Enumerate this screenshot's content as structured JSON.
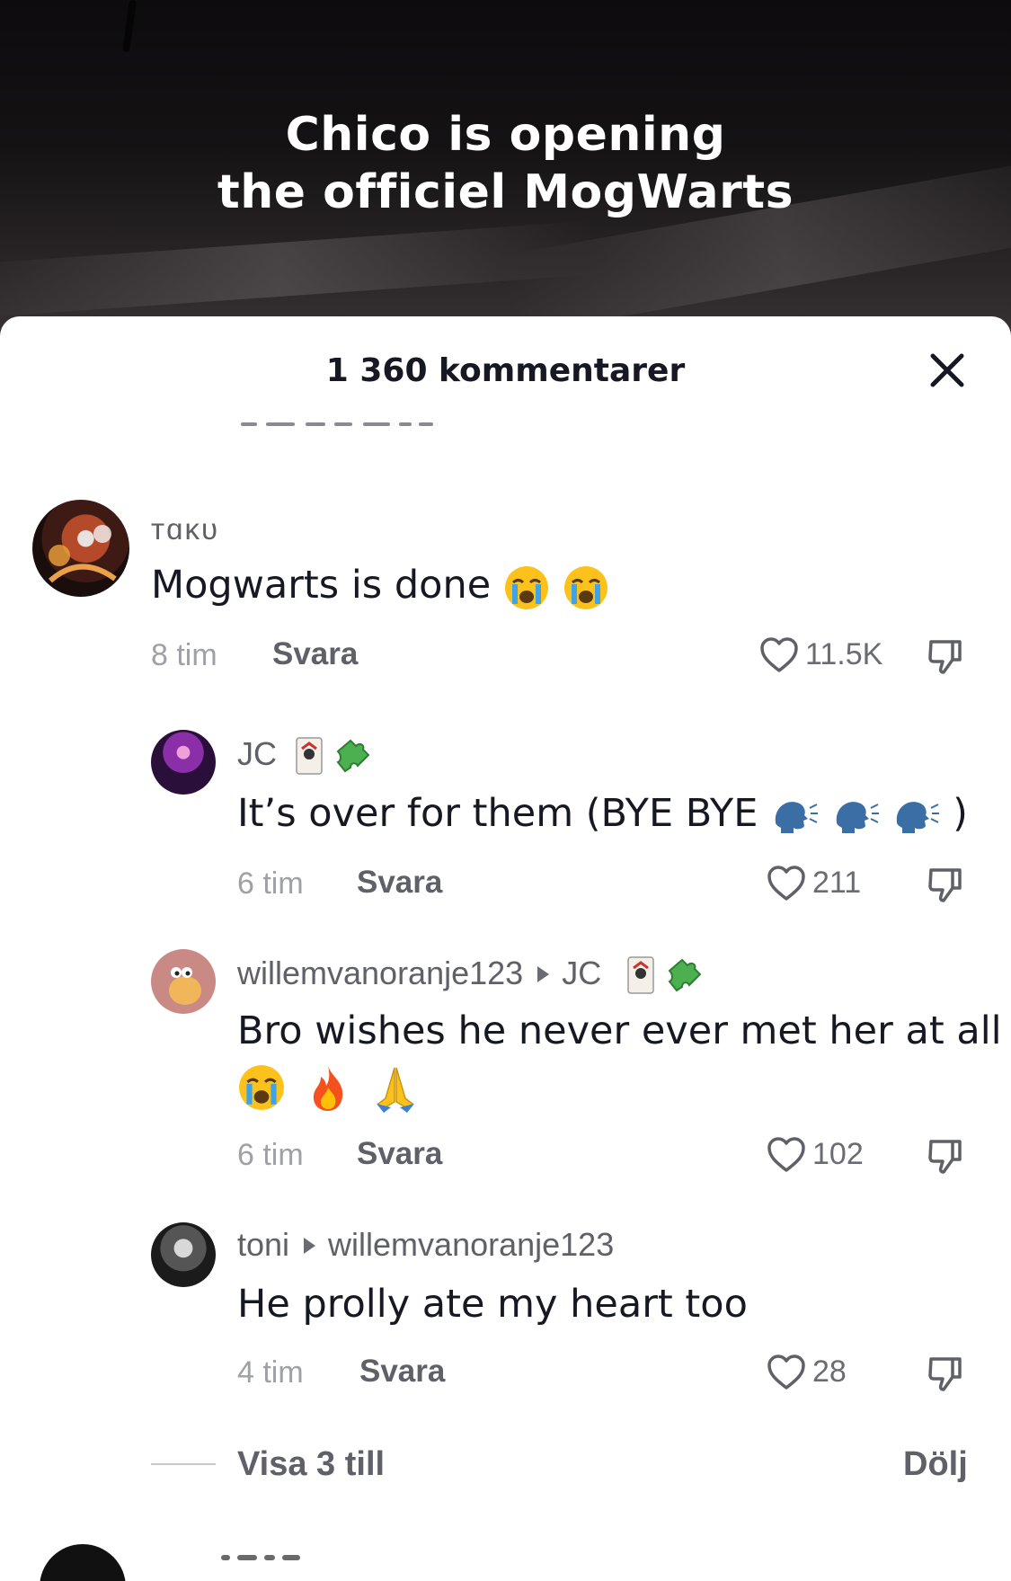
{
  "video": {
    "caption_line1": "Chico is opening",
    "caption_line2": "the officiel MogWarts"
  },
  "sheet": {
    "title": "1 360 kommentarer",
    "close_icon": "close-icon"
  },
  "comments": [
    {
      "username": "ᴛɑκᴜ",
      "text": "Mogwarts is done",
      "emojis": [
        "loudly-crying-face",
        "loudly-crying-face"
      ],
      "time": "8 tim",
      "reply_label": "Svara",
      "likes": "11.5K"
    },
    {
      "username": "JC",
      "username_emojis": [
        "joker-card",
        "puzzle-piece"
      ],
      "text": "It’s over for them (BYE BYE",
      "text_emojis": [
        "speaking-head",
        "speaking-head",
        "speaking-head"
      ],
      "text_suffix": ")",
      "time": "6 tim",
      "reply_label": "Svara",
      "likes": "211"
    },
    {
      "username": "willemvanoranje123",
      "reply_to": "JC",
      "reply_to_emojis": [
        "joker-card",
        "puzzle-piece"
      ],
      "text": "Bro wishes he never ever met her at all",
      "text_emojis": [
        "loudly-crying-face",
        "fire",
        "folded-hands"
      ],
      "time": "6 tim",
      "reply_label": "Svara",
      "likes": "102"
    },
    {
      "username": "toni",
      "reply_to": "willemvanoranje123",
      "text": "He prolly ate my heart too",
      "time": "4 tim",
      "reply_label": "Svara",
      "likes": "28"
    }
  ],
  "footer": {
    "show_more": "Visa 3 till",
    "hide": "Dölj"
  }
}
